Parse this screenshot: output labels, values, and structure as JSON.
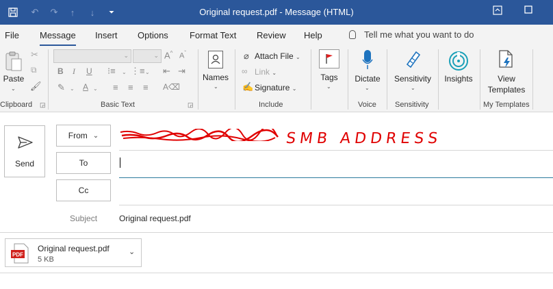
{
  "window": {
    "title": "Original request.pdf  -  Message (HTML)"
  },
  "menu": {
    "tabs": [
      "File",
      "Message",
      "Insert",
      "Options",
      "Format Text",
      "Review",
      "Help"
    ],
    "active": "Message",
    "tell_me": "Tell me what you want to do"
  },
  "ribbon": {
    "clipboard": {
      "paste": "Paste",
      "label": "Clipboard"
    },
    "basic_text": {
      "label": "Basic Text"
    },
    "names": {
      "label": "Names"
    },
    "include": {
      "attach_file": "Attach File",
      "link": "Link",
      "signature": "Signature",
      "label": "Include"
    },
    "tags": {
      "label": "Tags"
    },
    "voice": {
      "dictate": "Dictate",
      "label": "Voice"
    },
    "sensitivity": {
      "button": "Sensitivity",
      "label": "Sensitivity"
    },
    "insights": {
      "button": "Insights"
    },
    "templates": {
      "line1": "View",
      "line2": "Templates",
      "label": "My Templates"
    }
  },
  "compose": {
    "send": "Send",
    "from": "From",
    "to": "To",
    "cc": "Cc",
    "subject_label": "Subject",
    "subject_value": "Original request.pdf",
    "annotation": "SMB ADDRESS",
    "attachment": {
      "name": "Original request.pdf",
      "size": "5 KB",
      "icon_text": "PDF"
    }
  },
  "colors": {
    "titlebar": "#2b579a",
    "annotation": "#e00000",
    "pdf_icon": "#d0201b"
  }
}
